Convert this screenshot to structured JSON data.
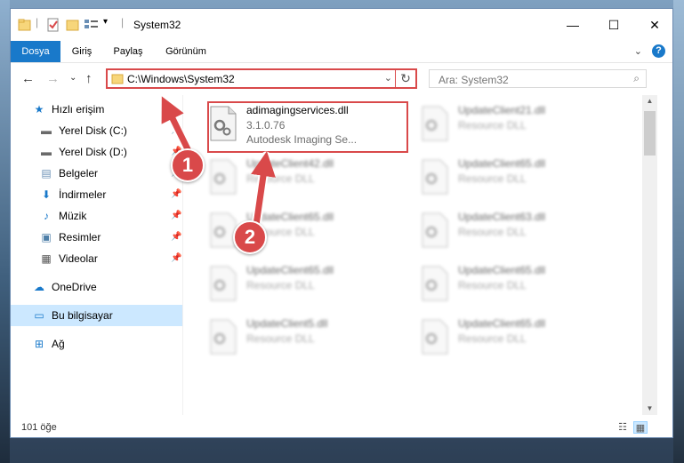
{
  "window": {
    "title": "System32",
    "controls": {
      "minimize": "—",
      "maximize": "☐",
      "close": "✕"
    }
  },
  "ribbon": {
    "tabs": [
      {
        "label": "Dosya",
        "active": true
      },
      {
        "label": "Giriş",
        "active": false
      },
      {
        "label": "Paylaş",
        "active": false
      },
      {
        "label": "Görünüm",
        "active": false
      }
    ],
    "help": "?"
  },
  "navigation": {
    "address": "C:\\Windows\\System32",
    "search_placeholder": "Ara: System32"
  },
  "sidebar": {
    "items": [
      {
        "label": "Hızlı erişim",
        "icon": "star-icon",
        "glyph": "★",
        "color": "#1979ca",
        "pinned": false
      },
      {
        "label": "Yerel Disk (C:)",
        "icon": "drive-c-icon",
        "glyph": "▬",
        "color": "#6a6a6a",
        "pinned": true
      },
      {
        "label": "Yerel Disk (D:)",
        "icon": "drive-d-icon",
        "glyph": "▬",
        "color": "#6a6a6a",
        "pinned": true
      },
      {
        "label": "Belgeler",
        "icon": "documents-icon",
        "glyph": "▤",
        "color": "#6a8fb5",
        "pinned": true
      },
      {
        "label": "İndirmeler",
        "icon": "download-icon",
        "glyph": "⬇",
        "color": "#1979ca",
        "pinned": true
      },
      {
        "label": "Müzik",
        "icon": "music-icon",
        "glyph": "♪",
        "color": "#1979ca",
        "pinned": true
      },
      {
        "label": "Resimler",
        "icon": "pictures-icon",
        "glyph": "▣",
        "color": "#4e7fa8",
        "pinned": true
      },
      {
        "label": "Videolar",
        "icon": "videos-icon",
        "glyph": "▦",
        "color": "#555555",
        "pinned": true
      },
      {
        "label": "OneDrive",
        "icon": "cloud-icon",
        "glyph": "☁",
        "color": "#1979ca",
        "pinned": false
      },
      {
        "label": "Bu bilgisayar",
        "icon": "computer-icon",
        "glyph": "▭",
        "color": "#1979ca",
        "pinned": false,
        "selected": true
      },
      {
        "label": "Ağ",
        "icon": "network-icon",
        "glyph": "⊞",
        "color": "#1979ca",
        "pinned": false
      }
    ],
    "pin_glyph": "📌"
  },
  "files": [
    {
      "name": "adimagingservices.dll",
      "version": "3.1.0.76",
      "desc": "Autodesk Imaging Se...",
      "blurred": false
    },
    {
      "name": "UpdateClient21.dll",
      "version": "Resource DLL",
      "desc": "",
      "blurred": true
    },
    {
      "name": "UpdateClient42.dll",
      "version": "Resource DLL",
      "desc": "",
      "blurred": true
    },
    {
      "name": "UpdateClient65.dll",
      "version": "Resource DLL",
      "desc": "",
      "blurred": true
    },
    {
      "name": "UpdateClient65.dll",
      "version": "Resource DLL",
      "desc": "",
      "blurred": true
    },
    {
      "name": "UpdateClient63.dll",
      "version": "Resource DLL",
      "desc": "",
      "blurred": true
    },
    {
      "name": "UpdateClient65.dll",
      "version": "Resource DLL",
      "desc": "",
      "blurred": true
    },
    {
      "name": "UpdateClient65.dll",
      "version": "Resource DLL",
      "desc": "",
      "blurred": true
    },
    {
      "name": "UpdateClient5.dll",
      "version": "Resource DLL",
      "desc": "",
      "blurred": true
    },
    {
      "name": "UpdateClient65.dll",
      "version": "Resource DLL",
      "desc": "",
      "blurred": true
    }
  ],
  "status": {
    "item_count": "101 öğe"
  },
  "annotations": {
    "badge1": "1",
    "badge2": "2",
    "color": "#d9494a"
  }
}
